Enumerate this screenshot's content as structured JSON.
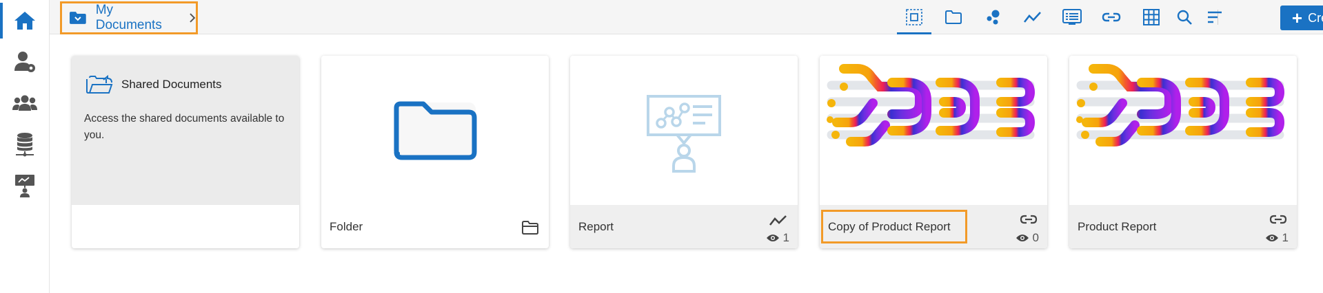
{
  "sidebar": {
    "items": [
      {
        "icon": "home-icon",
        "active": true
      },
      {
        "icon": "user-settings-icon"
      },
      {
        "icon": "users-group-icon"
      },
      {
        "icon": "database-icon"
      },
      {
        "icon": "presenter-icon"
      }
    ]
  },
  "breadcrumb": {
    "label": "My Documents"
  },
  "toolbar": {
    "icons": [
      "grid-select-icon",
      "folder-icon",
      "scatter-icon",
      "line-chart-icon",
      "list-icon",
      "link-icon",
      "table-icon",
      "search-icon",
      "sort-icon"
    ],
    "create_label": "Create"
  },
  "cards": {
    "shared": {
      "title": "Shared Documents",
      "description": "Access the shared documents available to you."
    },
    "folder": {
      "title": "Folder"
    },
    "report": {
      "title": "Report",
      "views": "1"
    },
    "copy_product_report": {
      "title": "Copy of Product Report",
      "views": "0"
    },
    "product_report": {
      "title": "Product Report",
      "views": "1"
    }
  },
  "colors": {
    "accent": "#1a72c3",
    "highlight": "#f29a28"
  }
}
